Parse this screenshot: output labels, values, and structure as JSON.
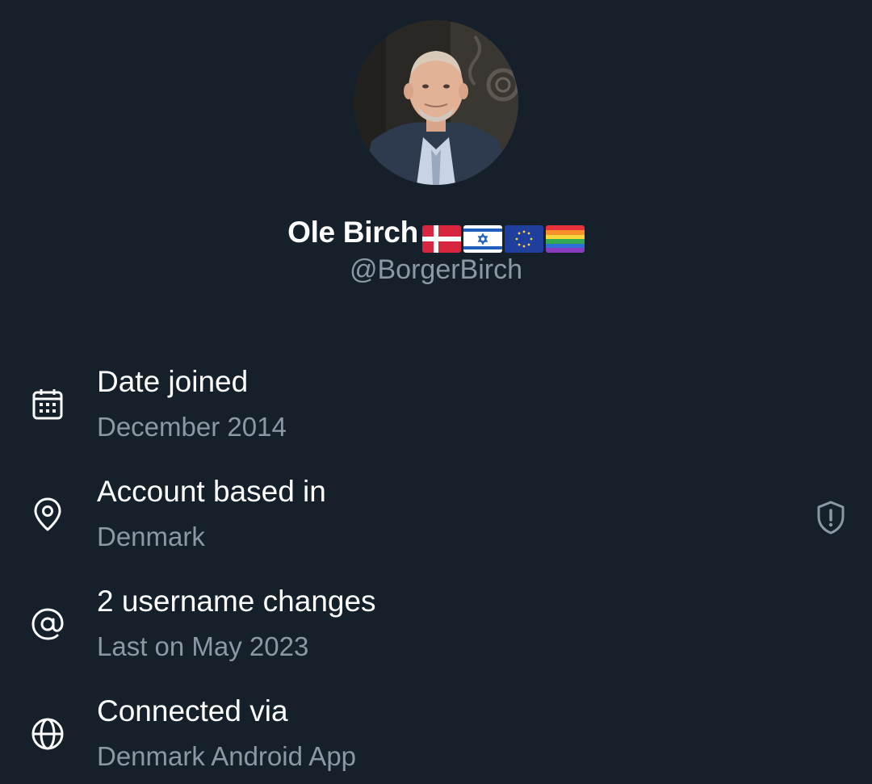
{
  "profile": {
    "display_name": "Ole Birch",
    "handle": "@BorgerBirch",
    "name_flags": [
      "denmark-flag-icon",
      "israel-flag-icon",
      "eu-flag-icon",
      "rainbow-flag-icon"
    ]
  },
  "about": {
    "items": [
      {
        "icon": "calendar-icon",
        "title": "Date joined",
        "value": "December 2014"
      },
      {
        "icon": "location-pin-icon",
        "title": "Account based in",
        "value": "Denmark",
        "trailing_icon": "shield-alert-icon"
      },
      {
        "icon": "at-sign-icon",
        "title": "2 username changes",
        "value": "Last on May 2023"
      },
      {
        "icon": "globe-icon",
        "title": "Connected via",
        "value": "Denmark Android App"
      }
    ]
  },
  "colors": {
    "background": "#15202b",
    "primary_text": "#ffffff",
    "secondary_text": "#8b98a5"
  }
}
